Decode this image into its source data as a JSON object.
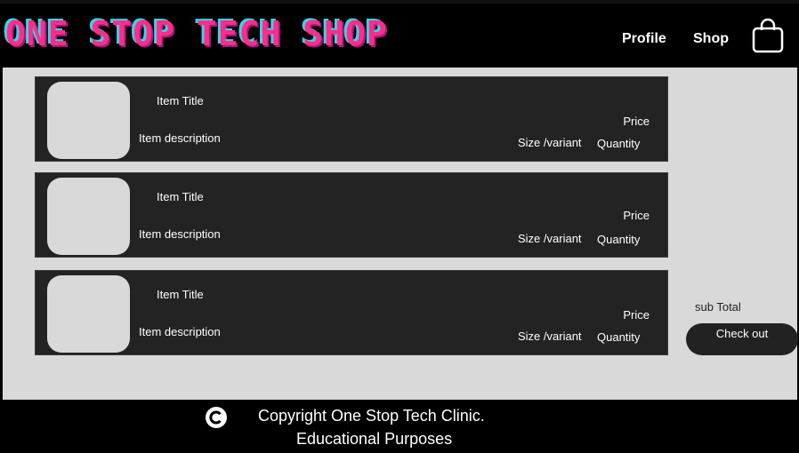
{
  "header": {
    "logo_text": "ONE STOP TECH SHOP",
    "nav": {
      "profile": "Profile",
      "shop": "Shop"
    },
    "cart_icon": "shopping-bag-icon"
  },
  "cart": {
    "items": [
      {
        "title": "Item Title",
        "description": "Item description",
        "price": "Price",
        "variant": "Size /variant",
        "quantity": "Quantity"
      },
      {
        "title": "Item Title",
        "description": "Item description",
        "price": "Price",
        "variant": "Size /variant",
        "quantity": "Quantity"
      },
      {
        "title": "Item Title",
        "description": "Item description",
        "price": "Price",
        "variant": "Size /variant",
        "quantity": "Quantity"
      }
    ],
    "subtotal_label": "sub Total",
    "checkout_label": "Check out"
  },
  "footer": {
    "icon": "copyright-icon",
    "line1": "Copyright One Stop Tech Clinic.",
    "line2": "Educational Purposes"
  },
  "colors": {
    "logo_primary": "#ff2d8a",
    "logo_shadow": "#2fd8e8",
    "card_bg": "#232323",
    "page_bg": "#d9d9d9"
  }
}
